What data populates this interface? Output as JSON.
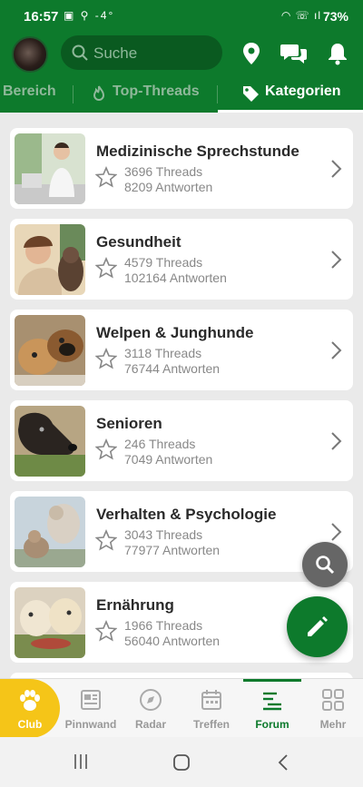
{
  "status_bar": {
    "time": "16:57",
    "left_icons": "▣ ⚲ -4°",
    "right_icons": "◠ ☏ ıl",
    "battery": "73%"
  },
  "header": {
    "search_placeholder": "Suche",
    "icons": [
      "location-pin-icon",
      "chat-bubbles-icon",
      "bell-icon"
    ]
  },
  "tabs": [
    {
      "label": "Bereich",
      "active": false
    },
    {
      "label": "Top-Threads",
      "active": false
    },
    {
      "label": "Kategorien",
      "active": true
    }
  ],
  "categories": [
    {
      "title": "Medizinische Sprechstunde",
      "threads": "3696 Threads",
      "answers": "8209 Antworten"
    },
    {
      "title": "Gesundheit",
      "threads": "4579 Threads",
      "answers": "102164 Antworten"
    },
    {
      "title": "Welpen & Junghunde",
      "threads": "3118 Threads",
      "answers": "76744 Antworten"
    },
    {
      "title": "Senioren",
      "threads": "246 Threads",
      "answers": "7049 Antworten"
    },
    {
      "title": "Verhalten & Psychologie",
      "threads": "3043 Threads",
      "answers": "77977 Antworten"
    },
    {
      "title": "Ernährung",
      "threads": "1966 Threads",
      "answers": "56040 Antworten"
    }
  ],
  "bottom_nav": [
    {
      "label": "Club",
      "icon": "paw-icon"
    },
    {
      "label": "Pinnwand",
      "icon": "newspaper-icon"
    },
    {
      "label": "Radar",
      "icon": "compass-icon"
    },
    {
      "label": "Treffen",
      "icon": "calendar-icon"
    },
    {
      "label": "Forum",
      "icon": "forum-icon"
    },
    {
      "label": "Mehr",
      "icon": "grid-icon"
    }
  ],
  "colors": {
    "brand_green": "#0d7a2c",
    "club_yellow": "#f5c518",
    "fab_gray": "#666666"
  }
}
